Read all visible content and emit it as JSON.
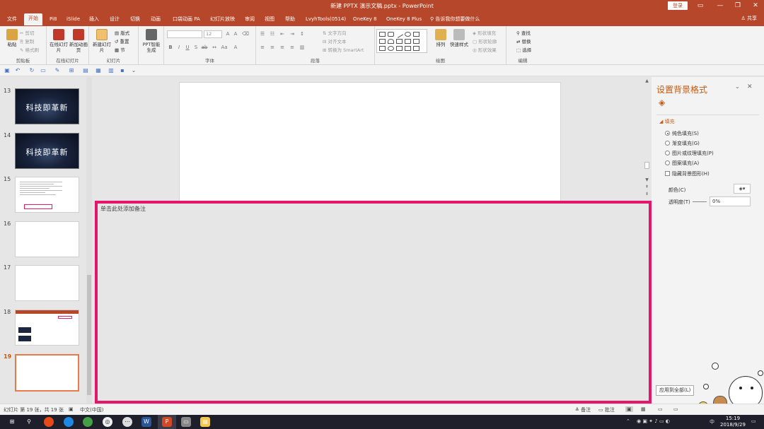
{
  "window": {
    "title": "新建 PPTX 演示文稿.pptx  -  PowerPoint",
    "login": "登录",
    "share": "共享"
  },
  "tabs": [
    "文件",
    "开始",
    "Pi8",
    "iSlide",
    "插入",
    "设计",
    "切换",
    "动画",
    "口袋动画 PA",
    "幻灯片放映",
    "审阅",
    "视图",
    "帮助",
    "LvyhTools(0514)",
    "OneKey 8",
    "OneKey 8 Plus"
  ],
  "tell_me": "告诉我你想要做什么",
  "ribbon": {
    "clipboard": {
      "paste": "粘贴",
      "cut": "剪切",
      "copy": "复制",
      "format_painter": "格式刷",
      "label": "剪贴板"
    },
    "online": {
      "online_slides": "在线幻灯片",
      "new_anim": "新加动画页",
      "label": "在线幻灯片"
    },
    "slides": {
      "new_slide": "新建幻灯片",
      "layout": "版式",
      "reset": "重置",
      "section": "节",
      "label": "幻灯片"
    },
    "ppt_smart": {
      "label": "PPT智能生成"
    },
    "font": {
      "font_size": "12",
      "label": "字体"
    },
    "paragraph": {
      "text_direction": "文字方向",
      "align_text": "对齐文本",
      "smartart": "转换为 SmartArt",
      "label": "段落"
    },
    "drawing": {
      "arrange": "排列",
      "quick_styles": "快速样式",
      "fill": "形状填充",
      "outline": "形状轮廓",
      "effects": "形状效果",
      "label": "绘图"
    },
    "editing": {
      "find": "查找",
      "replace": "替换",
      "select": "选择",
      "label": "编辑"
    }
  },
  "thumbnails": [
    {
      "num": "13",
      "kind": "dark",
      "text": "科技即革新"
    },
    {
      "num": "14",
      "kind": "dark",
      "text": "科技即革新"
    },
    {
      "num": "15",
      "kind": "doc",
      "text": ""
    },
    {
      "num": "16",
      "kind": "blank",
      "text": ""
    },
    {
      "num": "17",
      "kind": "blank",
      "text": ""
    },
    {
      "num": "18",
      "kind": "screenshot",
      "text": ""
    },
    {
      "num": "19",
      "kind": "selected",
      "text": ""
    }
  ],
  "notes": {
    "placeholder": "单击此处添加备注"
  },
  "format_pane": {
    "title": "设置背景格式",
    "section": "填充",
    "options": [
      "纯色填充(S)",
      "渐变填充(G)",
      "图片或纹理填充(P)",
      "图案填充(A)"
    ],
    "selected_option": 0,
    "hide_bg": "隐藏背景图形(H)",
    "color_label": "颜色(C)",
    "transparency_label": "透明度(T)",
    "transparency_value": "0%",
    "apply_all": "应用到全部(L)"
  },
  "status": {
    "slide_info": "幻灯片 第 19 张，共 19 张",
    "language": "中文(中国)",
    "notes_btn": "备注",
    "comments_btn": "批注"
  },
  "taskbar": {
    "time": "15:19",
    "date": "2018/9/29",
    "ime": "中"
  },
  "colors": {
    "accent": "#b7472a",
    "highlight_box": "#e5166a",
    "pane_title": "#c55a11"
  }
}
